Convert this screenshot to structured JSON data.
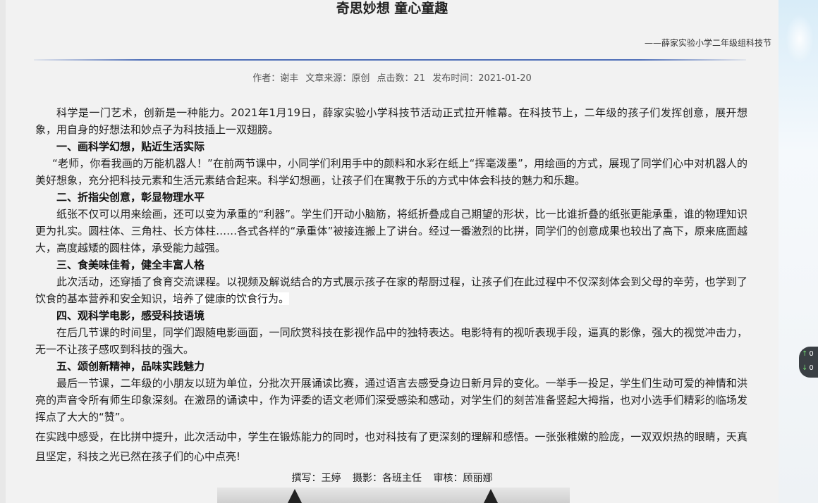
{
  "article": {
    "title": "奇思妙想 童心童趣",
    "byline": "——薛家实验小学二年级组科技节",
    "meta": {
      "author": "作者：谢丰",
      "source": "文章来源：原创",
      "clicks": "点击数：21",
      "date": "发布时间：2021-01-20"
    },
    "paragraphs": {
      "intro": "科学是一门艺术，创新是一种能力。2021年1月19日，薛家实验小学科技节活动正式拉开帷幕。在科技节上，二年级的孩子们发挥创意，展开想象，用自身的好想法和妙点子为科技插上一双翅膀。",
      "h1": "一、画科学幻想，贴近生活实际",
      "p1": "“老师，你看我画的万能机器人！”在前两节课中，小同学们利用手中的颜料和水彩在纸上“挥毫泼墨”，用绘画的方式，展现了同学们心中对机器人的美好想象，充分把科技元素和生活元素结合起来。科学幻想画，让孩子们在寓教于乐的方式中体会科技的魅力和乐趣。",
      "h2": "二、折指尖创意，彰显物理水平",
      "p2": "纸张不仅可以用来绘画，还可以变为承重的“利器”。学生们开动小脑筋，将纸折叠成自己期望的形状，比一比谁折叠的纸张更能承重，谁的物理知识更为扎实。圆柱体、三角柱、长方体柱……各式各样的“承重体”被接连搬上了讲台。经过一番激烈的比拼，同学们的创意成果也较出了高下，原来底面越大，高度越矮的圆柱体，承受能力越强。",
      "h3": "三、食美味佳肴，健全丰富人格",
      "p3a": "此次活动，还穿插了食育交流课程。以视频及解说结合的方式展示孩子在家的帮厨过程，让孩子们在此过程中不仅深刻体会到父母的辛劳，也学到了饮食的基本营养和安全知识，",
      "p3b": "培养了健康的饮食行为。",
      "h4": "四、观科学电影，感受科技语境",
      "p4": "在后几节课的时间里，同学们跟随电影画面，一同欣赏科技在影视作品中的独特表达。电影特有的视听表现手段，逼真的影像，强大的视觉冲击力，无一不让孩子感叹到科技的强大。",
      "h5": "五、颂创新精神，品味实践魅力",
      "p5": "最后一节课，二年级的小朋友以班为单位，分批次开展诵读比赛，通过语言去感受身边日新月异的变化。一举手一投足，学生们生动可爱的神情和洪亮的声音令所有师生印象深刻。在激昂的诵读中，作为评委的语文老师们深受感染和感动，对学生们的刻苦准备竖起大拇指，也对小选手们精彩的临场发挥点了大大的“赞”。",
      "closing": "在实践中感受，在比拼中提升，此次活动中，学生在锻炼能力的同时，也对科技有了更深刻的理解和感悟。一张张稚嫩的脸庞，一双双炽热的眼睛，天真且坚定，科技之光已然在孩子们的心中点亮!"
    },
    "credits": {
      "writer": "撰写：王婷",
      "photo": "摄影：各班主任",
      "review": "审核：顾丽娜"
    }
  },
  "widget": {
    "up_arrow": "↑",
    "down_arrow": "↓",
    "up_text": "0",
    "down_text": "0"
  }
}
